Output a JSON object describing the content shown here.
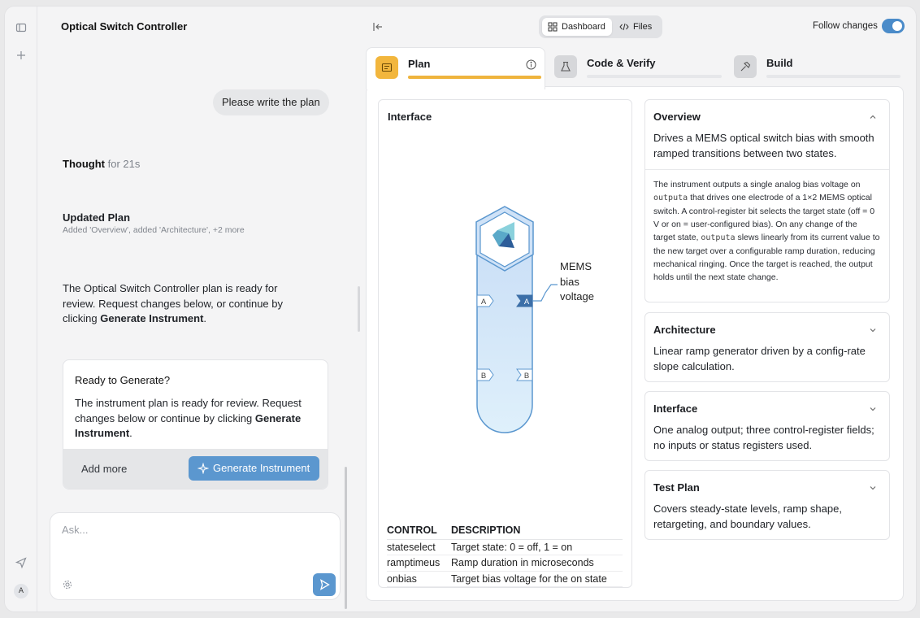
{
  "chat": {
    "title": "Optical Switch Controller",
    "user_message": "Please write the plan",
    "thought_label": "Thought",
    "thought_time": "for 21s",
    "update_title": "Updated Plan",
    "update_sub": "Added 'Overview', added 'Architecture', +2 more",
    "ready_text_1": "The Optical Switch Controller plan is ready for review. Request changes below, or continue by clicking ",
    "ready_text_bold": "Generate Instrument",
    "ready_text_end": ".",
    "card": {
      "title": "Ready to Generate?",
      "body_1": "The instrument plan is ready for review. Request changes below or continue by clicking ",
      "body_bold": "Generate Instrument",
      "body_end": ".",
      "add_more": "Add more",
      "generate": "Generate Instrument"
    },
    "ask_placeholder": "Ask..."
  },
  "rail": {
    "avatar": "A"
  },
  "header": {
    "seg_dashboard": "Dashboard",
    "seg_files": "Files",
    "follow_label": "Follow changes",
    "follow_on": true
  },
  "tabs": [
    {
      "label": "Plan",
      "progress": 1.0
    },
    {
      "label": "Code & Verify",
      "progress": 0
    },
    {
      "label": "Build",
      "progress": 0
    }
  ],
  "interface": {
    "title": "Interface",
    "ports_left": [
      "A",
      "B"
    ],
    "ports_right": [
      "A",
      "B"
    ],
    "output_label_1": "MEMS",
    "output_label_2": "bias",
    "output_label_3": "voltage",
    "table_headers": [
      "CONTROL",
      "DESCRIPTION"
    ],
    "table_rows": [
      [
        "stateselect",
        "Target state: 0 = off, 1 = on"
      ],
      [
        "ramptimeus",
        "Ramp duration in microseconds"
      ],
      [
        "onbias",
        "Target bias voltage for the on state"
      ]
    ]
  },
  "sections": {
    "overview": {
      "title": "Overview",
      "summary": "Drives a MEMS optical switch bias with smooth ramped transitions between two states.",
      "d1": "The instrument outputs a single analog bias voltage on ",
      "c1": "outputa",
      "d2": " that drives one electrode of a 1×2 MEMS optical switch. A control-register bit selects the target state (off = 0 V or on = user-configured bias). On any change of the target state, ",
      "c2": "outputa",
      "d3": " slews linearly from its current value to the new target over a configurable ramp duration, reducing mechanical ringing. Once the target is reached, the output holds until the next state change."
    },
    "architecture": {
      "title": "Architecture",
      "summary": "Linear ramp generator driven by a config-rate slope calculation."
    },
    "interface": {
      "title": "Interface",
      "summary": "One analog output; three control-register fields; no inputs or status registers used."
    },
    "testplan": {
      "title": "Test Plan",
      "summary": "Covers steady-state levels, ramp shape, retargeting, and boundary values."
    }
  },
  "colors": {
    "accent": "#5b97cf",
    "plan_tab": "#f2b63d",
    "toggle": "#4a8bc9"
  }
}
